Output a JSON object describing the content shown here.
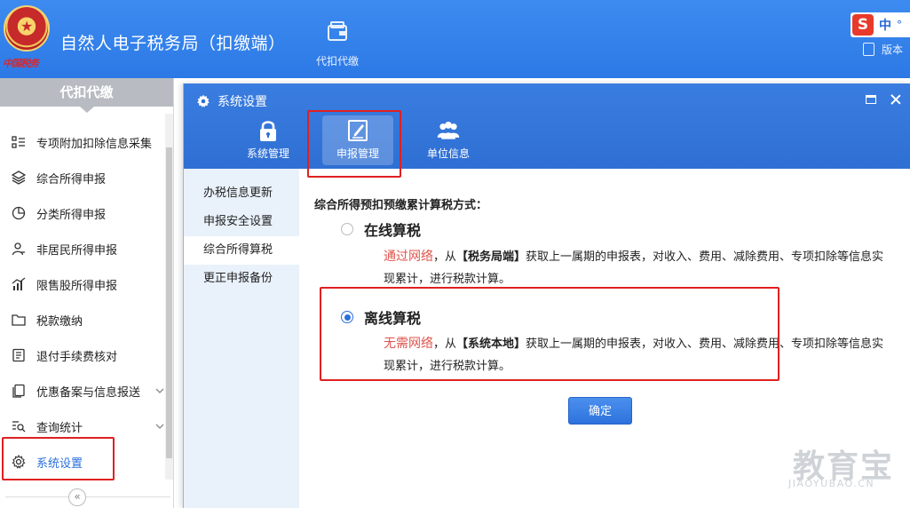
{
  "app": {
    "title": "自然人电子税务局（扣缴端）",
    "emblem_text": "中国税务",
    "nav_tab": {
      "label": "代扣代缴",
      "icon": "wallet-icon"
    },
    "ime": {
      "logo": "S",
      "mode": "中",
      "extra": "°"
    },
    "version_label": "版本"
  },
  "sidebar": {
    "header": "代扣代缴",
    "items": [
      {
        "label": "专项附加扣除信息采集",
        "icon": "list-icon"
      },
      {
        "label": "综合所得申报",
        "icon": "layers-icon"
      },
      {
        "label": "分类所得申报",
        "icon": "pie-chart-icon"
      },
      {
        "label": "非居民所得申报",
        "icon": "person-icon"
      },
      {
        "label": "限售股所得申报",
        "icon": "bar-chart-icon"
      },
      {
        "label": "税款缴纳",
        "icon": "folder-icon"
      },
      {
        "label": "退付手续费核对",
        "icon": "document-icon"
      },
      {
        "label": "优惠备案与信息报送",
        "icon": "file-copy-icon",
        "expandable": true
      },
      {
        "label": "查询统计",
        "icon": "search-list-icon",
        "expandable": true
      },
      {
        "label": "系统设置",
        "icon": "gear-icon",
        "active": true
      }
    ],
    "collapse_glyph": "«"
  },
  "dialog": {
    "title": "系统设置",
    "tabs": [
      {
        "label": "系统管理",
        "icon": "lock-icon"
      },
      {
        "label": "申报管理",
        "icon": "edit-icon",
        "active": true
      },
      {
        "label": "单位信息",
        "icon": "users-icon"
      }
    ],
    "left_menu": [
      {
        "label": "办税信息更新"
      },
      {
        "label": "申报安全设置"
      },
      {
        "label": "综合所得算税",
        "active": true
      },
      {
        "label": "更正申报备份"
      }
    ],
    "section_label": "综合所得预扣预缴累计算税方式：",
    "options": [
      {
        "name": "在线算税",
        "selected": false,
        "highlight": "通过网络",
        "text_a": "，从",
        "bracket": "【税务局端】",
        "text_b": "获取上一属期的申报表，对收入、费用、减除费用、专项扣除等信息实现累计，进行税款计算。"
      },
      {
        "name": "离线算税",
        "selected": true,
        "highlight": "无需网络",
        "text_a": "，从",
        "bracket": "【系统本地】",
        "text_b": "获取上一属期的申报表，对收入、费用、减除费用、专项扣除等信息实现累计，进行税款计算。"
      }
    ],
    "ok_label": "确定"
  },
  "watermark": {
    "main": "教育宝",
    "sub": "JIAOYUBAO.CN"
  },
  "colors": {
    "topbar": "#2c79e6",
    "accent": "#2a6fdc",
    "highlight": "#e0544d",
    "annotation": "#e02020"
  }
}
